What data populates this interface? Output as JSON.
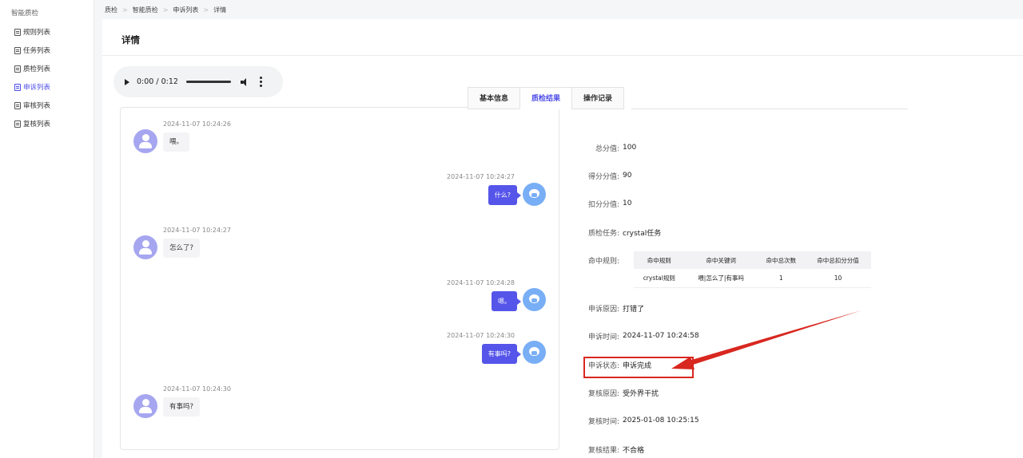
{
  "sidebar": {
    "group_label": "智能质检",
    "items": [
      {
        "label": "规则列表"
      },
      {
        "label": "任务列表"
      },
      {
        "label": "质检列表"
      },
      {
        "label": "申诉列表"
      },
      {
        "label": "审核列表"
      },
      {
        "label": "复核列表"
      }
    ],
    "active_item": "申诉列表"
  },
  "breadcrumb": [
    "质检",
    "智能质检",
    "申诉列表",
    "详情"
  ],
  "page_title": "详情",
  "audio": {
    "time": "0:00 / 0:12"
  },
  "chat": [
    {
      "side": "left",
      "timestamp": "2024-11-07 10:24:26",
      "text": "喂。"
    },
    {
      "side": "right",
      "timestamp": "2024-11-07 10:24:27",
      "text": "什么?"
    },
    {
      "side": "left",
      "timestamp": "2024-11-07 10:24:27",
      "text": "怎么了?"
    },
    {
      "side": "right",
      "timestamp": "2024-11-07 10:24:28",
      "text": "嗯。"
    },
    {
      "side": "right",
      "timestamp": "2024-11-07 10:24:30",
      "text": "有事吗?"
    },
    {
      "side": "left",
      "timestamp": "2024-11-07 10:24:30",
      "text": "有事吗?"
    }
  ],
  "tabs": [
    {
      "label": "基本信息"
    },
    {
      "label": "质检结果"
    },
    {
      "label": "操作记录"
    }
  ],
  "active_tab": "质检结果",
  "result": {
    "total_score": {
      "label": "总分值:",
      "value": "100"
    },
    "score": {
      "label": "得分分值:",
      "value": "90"
    },
    "deduct": {
      "label": "扣分分值:",
      "value": "10"
    },
    "task": {
      "label": "质检任务:",
      "value": "crystal任务"
    },
    "hit_rules_label": "命中规则:",
    "appeal_reason": {
      "label": "申诉原因:",
      "value": "打错了"
    },
    "appeal_time": {
      "label": "申诉时间:",
      "value": "2024-11-07 10:24:58"
    },
    "appeal_status": {
      "label": "申诉状态:",
      "value": "申诉完成"
    },
    "review_reason": {
      "label": "复核原因:",
      "value": "受外界干扰"
    },
    "review_time": {
      "label": "复核时间:",
      "value": "2025-01-08 10:25:15"
    },
    "review_result": {
      "label": "复核结果:",
      "value": "不合格"
    }
  },
  "rules_table": {
    "headers": [
      "命中规则",
      "命中关键词",
      "命中总次数",
      "命中总扣分分值"
    ],
    "rows": [
      [
        "crystal规则",
        "喂|怎么了|有事吗",
        "1",
        "10"
      ]
    ]
  },
  "colors": {
    "accent": "#4d4ce8",
    "annotation": "#d8271f",
    "bubble_right": "#5555ea"
  }
}
